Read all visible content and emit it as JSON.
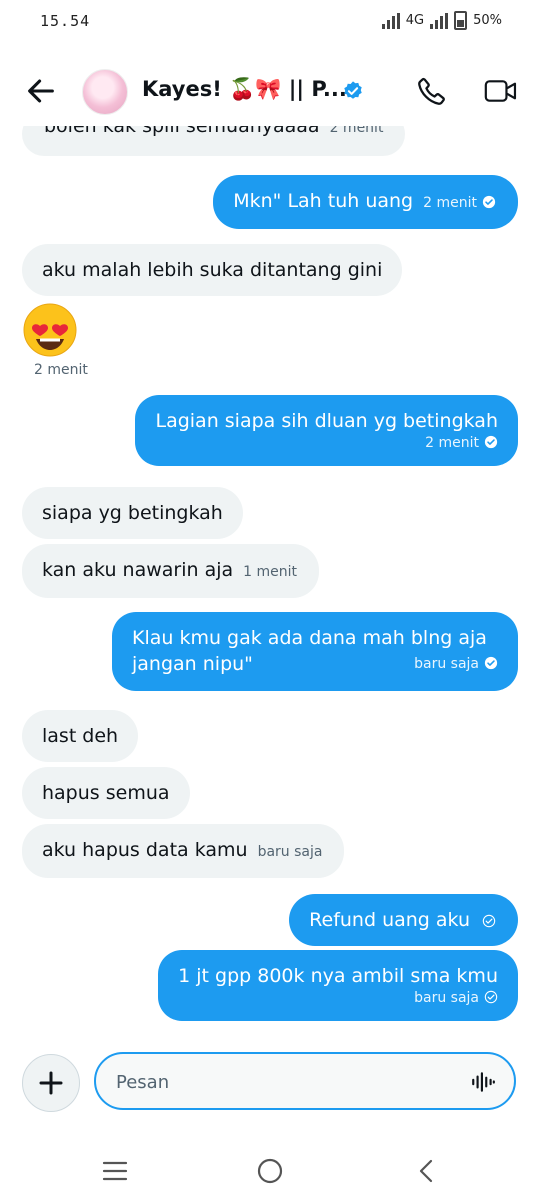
{
  "status_bar": {
    "time": "15.54",
    "network": "4G",
    "battery": "50%"
  },
  "header": {
    "title": "Kayes! 🍒🎀 || P...",
    "verified": true
  },
  "messages": [
    {
      "side": "in",
      "text": "boleh kak spill semuanyaaaa",
      "time": "2 menit"
    },
    {
      "side": "out",
      "text": "Mkn\" Lah tuh uang",
      "time": "2 menit"
    },
    {
      "side": "in",
      "text": "aku malah lebih suka ditantang gini"
    },
    {
      "side": "in",
      "type": "emoji",
      "emoji": "heart-eyes",
      "time": "2 menit"
    },
    {
      "side": "out",
      "text": "Lagian siapa sih dluan yg betingkah",
      "time": "2 menit"
    },
    {
      "side": "in",
      "text": "siapa yg betingkah"
    },
    {
      "side": "in",
      "text": "kan aku nawarin aja",
      "time": "1 menit"
    },
    {
      "side": "out",
      "lines": [
        "Klau kmu gak ada dana mah blng aja",
        "jangan nipu\""
      ],
      "time": "baru saja"
    },
    {
      "side": "in",
      "text": "last deh"
    },
    {
      "side": "in",
      "text": "hapus semua"
    },
    {
      "side": "in",
      "text": "aku hapus data kamu",
      "time": "baru saja"
    },
    {
      "side": "out",
      "text": "Refund uang aku",
      "status": "sent"
    },
    {
      "side": "out",
      "text": "1 jt gpp 800k nya ambil sma kmu",
      "time": "baru saja",
      "status": "sent"
    }
  ],
  "composer": {
    "placeholder": "Pesan"
  },
  "colors": {
    "accent": "#1d9bf0",
    "incoming_bubble": "#eff3f4",
    "text": "#0f1419",
    "muted": "#536471"
  }
}
